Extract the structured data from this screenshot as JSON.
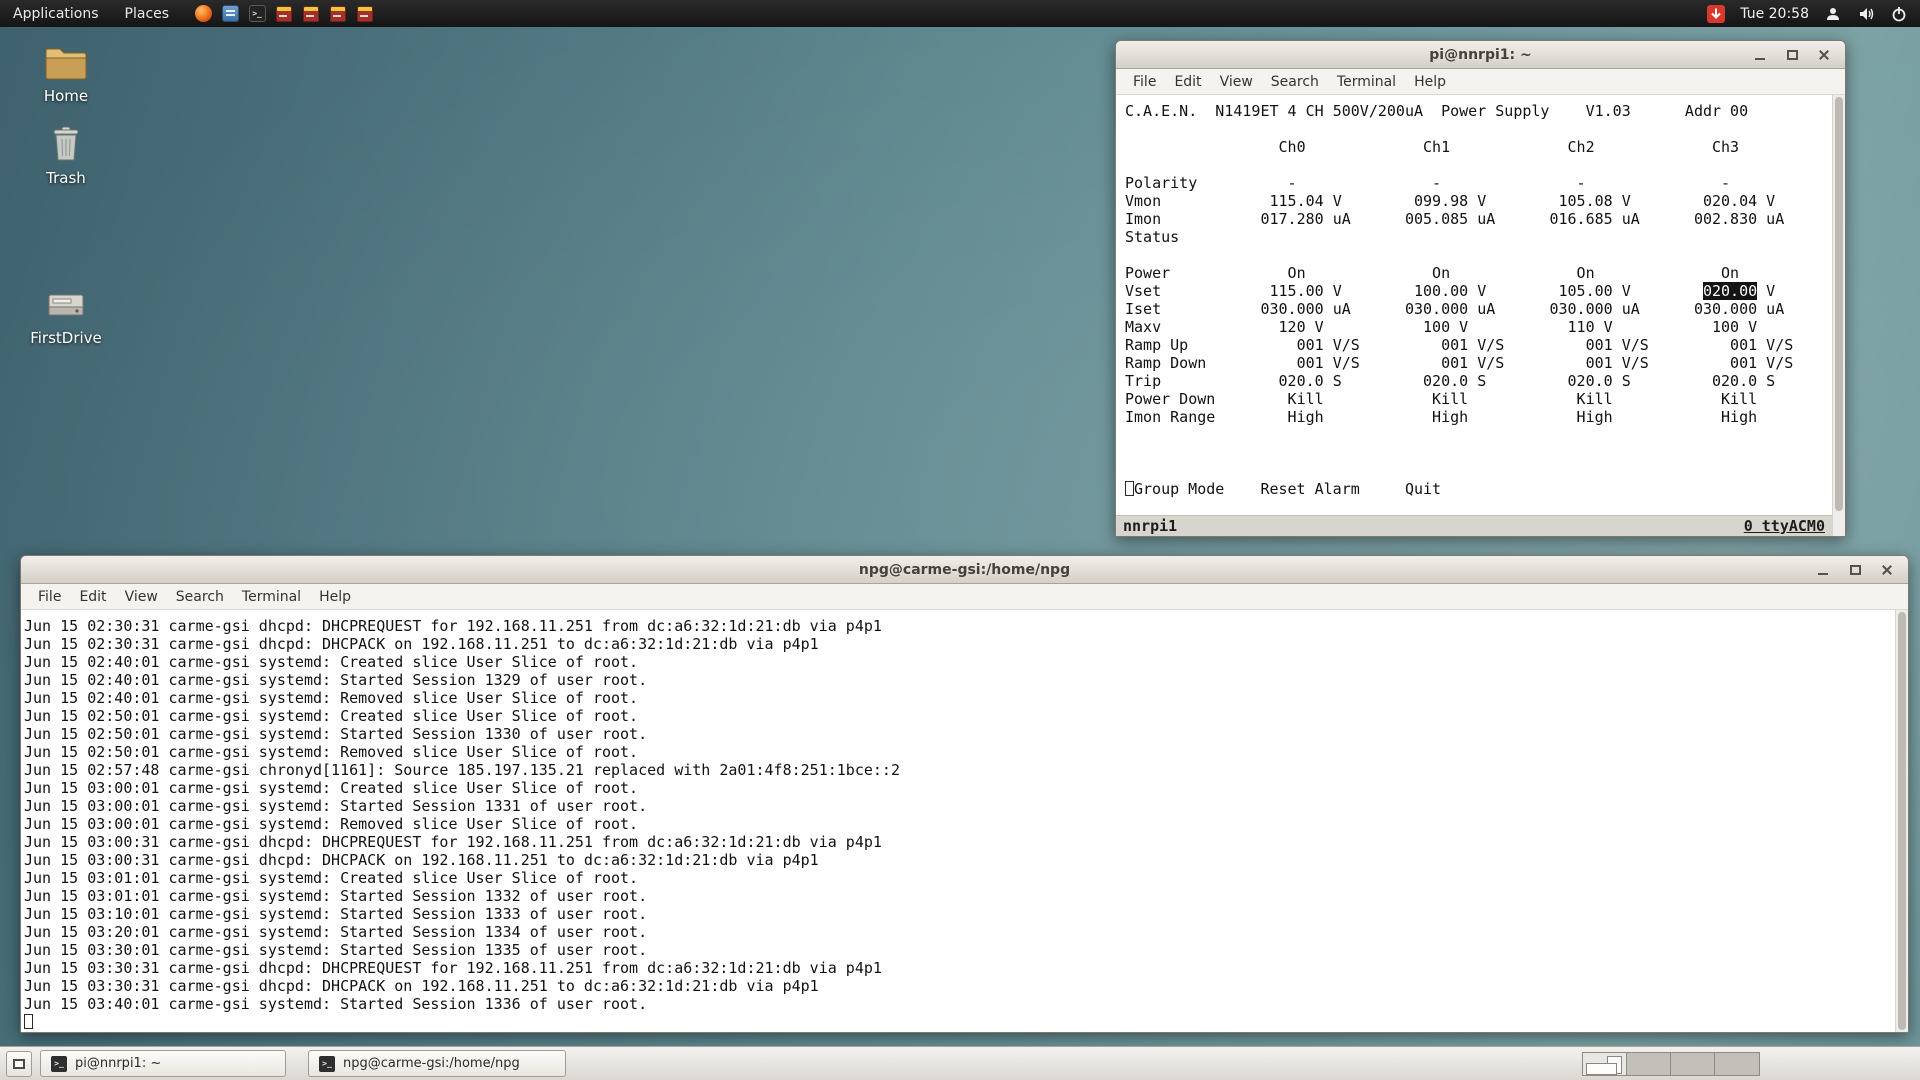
{
  "panel": {
    "menus": [
      {
        "label": "Applications"
      },
      {
        "label": "Places"
      }
    ],
    "launchers": [
      "browser",
      "file-manager",
      "terminal",
      "midas-app-1",
      "midas-app-2",
      "midas-app-3",
      "midas-app-4"
    ],
    "clock": "Tue 20:58",
    "status_icons": [
      "alert-indicator",
      "user",
      "volume",
      "power"
    ]
  },
  "icons": {
    "terminal_glyph": ">_"
  },
  "desktop": {
    "icons": [
      {
        "label": "Home",
        "icon": "home-folder"
      },
      {
        "label": "Trash",
        "icon": "trash-can"
      },
      {
        "label": "FirstDrive",
        "icon": "removable-drive"
      }
    ]
  },
  "terminal1": {
    "title": "pi@nnrpi1: ~",
    "menu": [
      "File",
      "Edit",
      "View",
      "Search",
      "Terminal",
      "Help"
    ],
    "status_left": "nnrpi1",
    "status_right": "0 ttyACM0",
    "screen": [
      [
        {
          "t": "C.A.E.N.  N1419ET 4 CH 500V/200uA  Power Supply    V1.03      Addr 00"
        }
      ],
      [],
      [
        {
          "t": "                 Ch0             Ch1             Ch2             Ch3"
        }
      ],
      [],
      [
        {
          "t": "Polarity          -               -               -               -"
        }
      ],
      [
        {
          "t": "Vmon            115.04 V        099.98 V        105.08 V        020.04 V"
        }
      ],
      [
        {
          "t": "Imon           017.280 uA      005.085 uA      016.685 uA      002.830 uA"
        }
      ],
      [
        {
          "t": "Status"
        }
      ],
      [],
      [
        {
          "t": "Power             On              On              On              On"
        }
      ],
      [
        {
          "t": "Vset            115.00 V        100.00 V        105.00 V        "
        },
        {
          "t": "020.00",
          "hl": true
        },
        {
          "t": " V"
        }
      ],
      [
        {
          "t": "Iset           030.000 uA      030.000 uA      030.000 uA      030.000 uA"
        }
      ],
      [
        {
          "t": "Maxv             120 V           100 V           110 V           100 V"
        }
      ],
      [
        {
          "t": "Ramp Up            001 V/S         001 V/S         001 V/S         001 V/S"
        }
      ],
      [
        {
          "t": "Ramp Down          001 V/S         001 V/S         001 V/S         001 V/S"
        }
      ],
      [
        {
          "t": "Trip             020.0 S         020.0 S         020.0 S         020.0 S"
        }
      ],
      [
        {
          "t": "Power Down        Kill            Kill            Kill            Kill"
        }
      ],
      [
        {
          "t": "Imon Range        High            High            High            High"
        }
      ],
      [],
      [],
      [],
      [
        {
          "cursor": true
        },
        {
          "t": "Group Mode",
          "btn": true
        },
        {
          "t": "    "
        },
        {
          "t": "Reset Alarm",
          "btn": true
        },
        {
          "t": "     "
        },
        {
          "t": "Quit",
          "btn": true
        }
      ]
    ]
  },
  "terminal2": {
    "title": "npg@carme-gsi:/home/npg",
    "menu": [
      "File",
      "Edit",
      "View",
      "Search",
      "Terminal",
      "Help"
    ],
    "log_lines": [
      "Jun 15 02:30:31 carme-gsi dhcpd: DHCPREQUEST for 192.168.11.251 from dc:a6:32:1d:21:db via p4p1",
      "Jun 15 02:30:31 carme-gsi dhcpd: DHCPACK on 192.168.11.251 to dc:a6:32:1d:21:db via p4p1",
      "Jun 15 02:40:01 carme-gsi systemd: Created slice User Slice of root.",
      "Jun 15 02:40:01 carme-gsi systemd: Started Session 1329 of user root.",
      "Jun 15 02:40:01 carme-gsi systemd: Removed slice User Slice of root.",
      "Jun 15 02:50:01 carme-gsi systemd: Created slice User Slice of root.",
      "Jun 15 02:50:01 carme-gsi systemd: Started Session 1330 of user root.",
      "Jun 15 02:50:01 carme-gsi systemd: Removed slice User Slice of root.",
      "Jun 15 02:57:48 carme-gsi chronyd[1161]: Source 185.197.135.21 replaced with 2a01:4f8:251:1bce::2",
      "Jun 15 03:00:01 carme-gsi systemd: Created slice User Slice of root.",
      "Jun 15 03:00:01 carme-gsi systemd: Started Session 1331 of user root.",
      "Jun 15 03:00:01 carme-gsi systemd: Removed slice User Slice of root.",
      "Jun 15 03:00:31 carme-gsi dhcpd: DHCPREQUEST for 192.168.11.251 from dc:a6:32:1d:21:db via p4p1",
      "Jun 15 03:00:31 carme-gsi dhcpd: DHCPACK on 192.168.11.251 to dc:a6:32:1d:21:db via p4p1",
      "Jun 15 03:01:01 carme-gsi systemd: Created slice User Slice of root.",
      "Jun 15 03:01:01 carme-gsi systemd: Started Session 1332 of user root.",
      "Jun 15 03:10:01 carme-gsi systemd: Started Session 1333 of user root.",
      "Jun 15 03:20:01 carme-gsi systemd: Started Session 1334 of user root.",
      "Jun 15 03:30:01 carme-gsi systemd: Started Session 1335 of user root.",
      "Jun 15 03:30:31 carme-gsi dhcpd: DHCPREQUEST for 192.168.11.251 from dc:a6:32:1d:21:db via p4p1",
      "Jun 15 03:30:31 carme-gsi dhcpd: DHCPACK on 192.168.11.251 to dc:a6:32:1d:21:db via p4p1",
      "Jun 15 03:40:01 carme-gsi systemd: Started Session 1336 of user root."
    ]
  },
  "taskbar": {
    "buttons": [
      "pi@nnrpi1: ~",
      "npg@carme-gsi:/home/npg"
    ],
    "workspaces": 4,
    "active_workspace": 1
  }
}
